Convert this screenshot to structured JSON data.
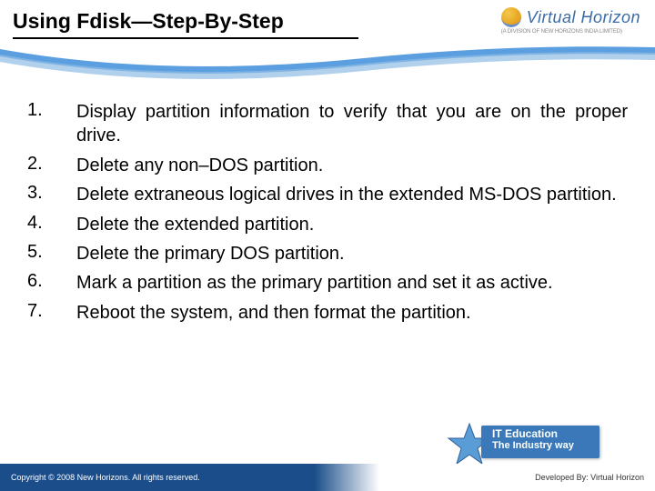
{
  "header": {
    "title": "Using Fdisk—Step-By-Step",
    "brand_name": "Virtual Horizon",
    "brand_sub": "(A DIVISION OF NEW HORIZONS INDIA LIMITED)"
  },
  "steps": [
    {
      "num": "1.",
      "text": "Display partition information to verify that you are on the proper drive."
    },
    {
      "num": "2.",
      "text": "Delete any non–DOS partition."
    },
    {
      "num": "3.",
      "text": "Delete extraneous logical drives in the extended MS-DOS partition."
    },
    {
      "num": "4.",
      "text": "Delete the extended partition."
    },
    {
      "num": "5.",
      "text": "Delete the primary DOS partition."
    },
    {
      "num": "6.",
      "text": "Mark a partition as the primary partition and set it as active."
    },
    {
      "num": "7.",
      "text": "Reboot the system, and then format the partition."
    }
  ],
  "badge": {
    "line1": "IT Education",
    "line2": "The Industry way"
  },
  "footer": {
    "copyright": "Copyright © 2008 New Horizons. All rights reserved.",
    "developed": "Developed By: Virtual Horizon"
  }
}
